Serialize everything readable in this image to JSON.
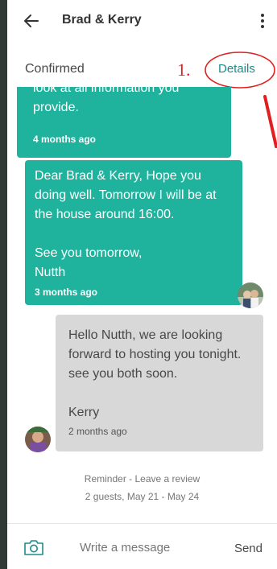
{
  "header": {
    "title": "Brad & Kerry"
  },
  "status_bar": {
    "status": "Confirmed",
    "annotation": "1.",
    "details_label": "Details"
  },
  "messages": [
    {
      "text": "look at all information you provide.",
      "time": "4 months ago"
    },
    {
      "text": "Dear Brad & Kerry, Hope you doing well. Tomorrow I will be at the house around 16:00.\n\nSee you tomorrow,\nNutth",
      "time": "3 months ago"
    },
    {
      "text": "Hello Nutth, we are looking forward to hosting you tonight. see you both soon.\n\nKerry",
      "time": "2 months ago"
    }
  ],
  "reminder": {
    "line1": "Reminder - Leave a review",
    "line2": "2 guests, May 21 - May 24"
  },
  "composer": {
    "placeholder": "Write a message",
    "send_label": "Send"
  },
  "colors": {
    "host_bubble": "#1fb39e",
    "guest_bubble": "#d8d8d8",
    "accent": "#1b8c8a",
    "annotation": "#e02020"
  }
}
